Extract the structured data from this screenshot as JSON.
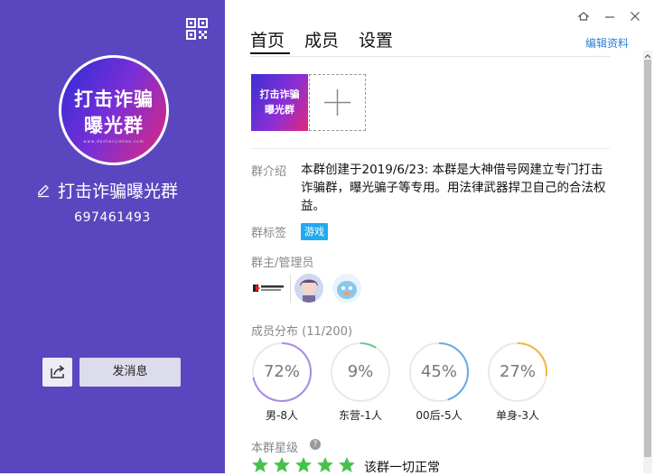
{
  "profile": {
    "avatar_text_line1": "打击诈骗",
    "avatar_text_line2": "曝光群",
    "avatar_small_text": "www.dashenjiehao.com",
    "group_name": "打击诈骗曝光群",
    "group_id": "697461493",
    "send_message_label": "发消息",
    "icons": [
      "qrcode-icon",
      "edit-icon",
      "share-icon"
    ]
  },
  "window": {
    "icons": [
      "skin-icon",
      "minimize-icon",
      "close-icon"
    ]
  },
  "tabs": [
    {
      "label": "首页",
      "active": true
    },
    {
      "label": "成员",
      "active": false
    },
    {
      "label": "设置",
      "active": false
    }
  ],
  "edit_profile_label": "编辑资料",
  "photos": {
    "photo_text_line1": "打击诈骗",
    "photo_text_line2": "曝光群",
    "add_icon": "plus-icon"
  },
  "intro": {
    "label": "群介绍",
    "text": "本群创建于2019/6/23: 本群是大神借号网建立专门打击诈骗群，曝光骗子等专用。用法律武器捍卫自己的合法权益。"
  },
  "tags": {
    "label": "群标签",
    "items": [
      "游戏"
    ]
  },
  "admins": {
    "label": "群主/管理员",
    "logo_text": "大神借号网"
  },
  "distribution": {
    "label": "成员分布",
    "count": "(11/200)",
    "rings": [
      {
        "percent_text": "72%",
        "value": 0.72,
        "label": "男-8人",
        "color": "#a98be6"
      },
      {
        "percent_text": "9%",
        "value": 0.09,
        "label": "东营-1人",
        "color": "#5fd08a"
      },
      {
        "percent_text": "45%",
        "value": 0.45,
        "label": "00后-5人",
        "color": "#6aa8e8"
      },
      {
        "percent_text": "27%",
        "value": 0.27,
        "label": "单身-3人",
        "color": "#f2b43a"
      }
    ]
  },
  "rating": {
    "label": "本群星级",
    "help_icon": "?",
    "stars": 5,
    "status": "该群一切正常",
    "star_color": "#46c24a"
  }
}
